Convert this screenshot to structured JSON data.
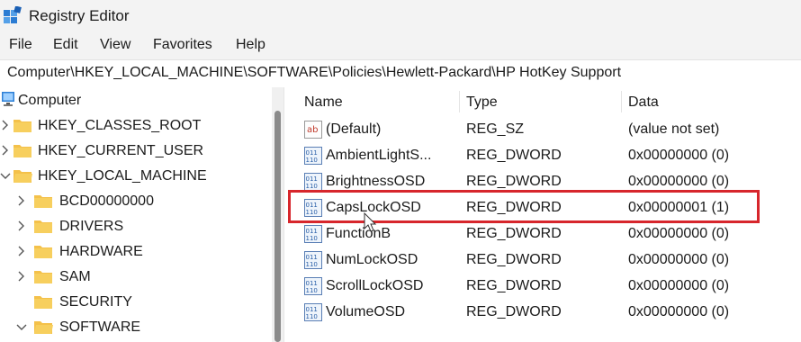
{
  "window": {
    "title": "Registry Editor"
  },
  "menu": [
    "File",
    "Edit",
    "View",
    "Favorites",
    "Help"
  ],
  "address": "Computer\\HKEY_LOCAL_MACHINE\\SOFTWARE\\Policies\\Hewlett-Packard\\HP HotKey Support",
  "tree": {
    "root": "Computer",
    "items": [
      {
        "label": "HKEY_CLASSES_ROOT",
        "expand": "collapsed"
      },
      {
        "label": "HKEY_CURRENT_USER",
        "expand": "collapsed"
      },
      {
        "label": "HKEY_LOCAL_MACHINE",
        "expand": "expanded"
      },
      {
        "label": "BCD00000000",
        "expand": "collapsed"
      },
      {
        "label": "DRIVERS",
        "expand": "collapsed"
      },
      {
        "label": "HARDWARE",
        "expand": "collapsed"
      },
      {
        "label": "SAM",
        "expand": "collapsed"
      },
      {
        "label": "SECURITY",
        "expand": "none"
      },
      {
        "label": "SOFTWARE",
        "expand": "expanded"
      }
    ]
  },
  "columns": {
    "name": "Name",
    "type": "Type",
    "data": "Data"
  },
  "values": [
    {
      "name": "(Default)",
      "type": "REG_SZ",
      "data": "(value not set)",
      "icon": "string-value-icon"
    },
    {
      "name": "AmbientLightS...",
      "type": "REG_DWORD",
      "data": "0x00000000 (0)",
      "icon": "dword-value-icon"
    },
    {
      "name": "BrightnessOSD",
      "type": "REG_DWORD",
      "data": "0x00000000 (0)",
      "icon": "dword-value-icon"
    },
    {
      "name": "CapsLockOSD",
      "type": "REG_DWORD",
      "data": "0x00000001 (1)",
      "icon": "dword-value-icon"
    },
    {
      "name": "FunctionB",
      "type": "REG_DWORD",
      "data": "0x00000000 (0)",
      "icon": "dword-value-icon"
    },
    {
      "name": "NumLockOSD",
      "type": "REG_DWORD",
      "data": "0x00000000 (0)",
      "icon": "dword-value-icon"
    },
    {
      "name": "ScrollLockOSD",
      "type": "REG_DWORD",
      "data": "0x00000000 (0)",
      "icon": "dword-value-icon"
    },
    {
      "name": "VolumeOSD",
      "type": "REG_DWORD",
      "data": "0x00000000 (0)",
      "icon": "dword-value-icon"
    }
  ],
  "colors": {
    "highlight": "#d7262c",
    "folder": "#f4c14a"
  }
}
